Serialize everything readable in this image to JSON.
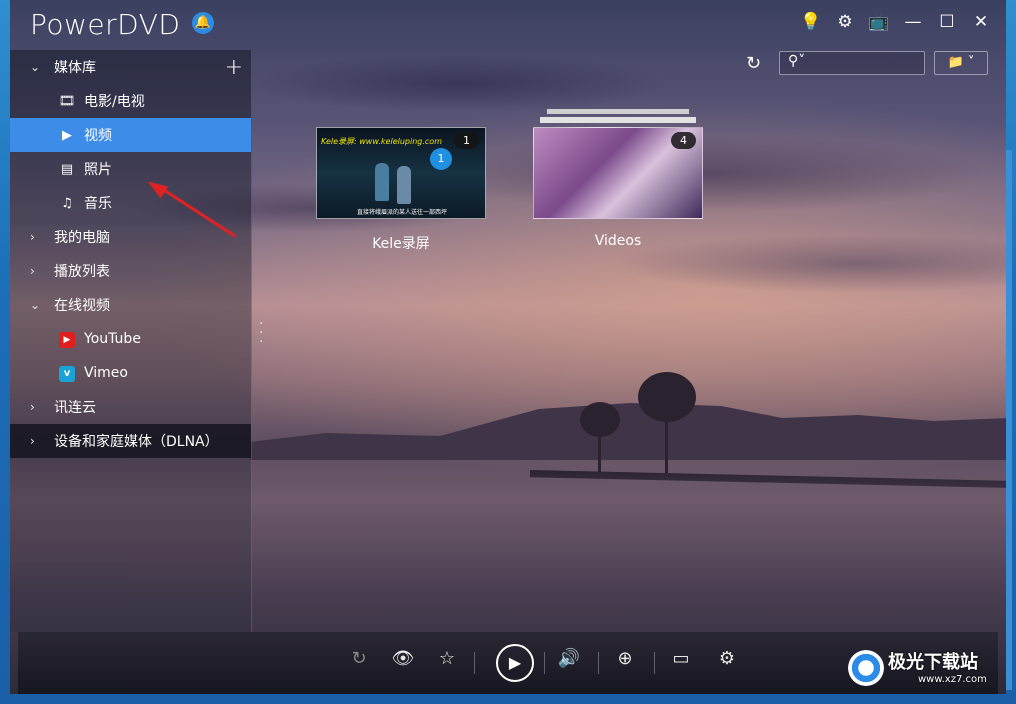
{
  "app": {
    "title": "PowerDVD"
  },
  "sidebar": {
    "media_library": "媒体库",
    "items": [
      {
        "label": "电影/电视",
        "icon": "film-icon"
      },
      {
        "label": "视频",
        "icon": "video-camera-icon",
        "active": true
      },
      {
        "label": "照片",
        "icon": "photo-icon"
      },
      {
        "label": "音乐",
        "icon": "music-note-icon"
      }
    ],
    "my_computer": "我的电脑",
    "playlist": "播放列表",
    "online_video": "在线视频",
    "online_items": [
      {
        "label": "YouTube",
        "icon": "youtube-icon"
      },
      {
        "label": "Vimeo",
        "icon": "vimeo-icon"
      }
    ],
    "cloud": "讯连云",
    "dlna": "设备和家庭媒体（DLNA）"
  },
  "thumbnails": [
    {
      "title": "Kele录屏",
      "count": "1",
      "url_text": "Kele录屏: www.keleluping.com",
      "inner_badge": "1",
      "subtitle": "直接将峨眉派的某人送往一部西坪"
    },
    {
      "title": "Videos",
      "count": "4"
    }
  ],
  "watermark": {
    "brand": "极光下载站",
    "site": "www.xz7.com"
  }
}
